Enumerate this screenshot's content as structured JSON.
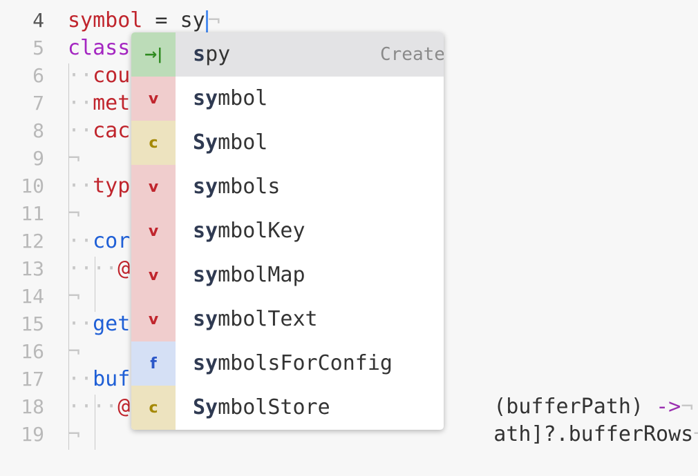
{
  "editor": {
    "lines": [
      {
        "num": "4",
        "current": true,
        "ws": "",
        "tokens": [
          [
            "kw-var",
            "symbol"
          ],
          [
            "plain",
            " = "
          ],
          [
            "plain",
            "sy"
          ]
        ],
        "cursor": true,
        "eol": "¬"
      },
      {
        "num": "5",
        "ws": "",
        "tokens": [
          [
            "kw-class",
            "class"
          ]
        ],
        "eol": ""
      },
      {
        "num": "6",
        "ws": "··",
        "tokens": [
          [
            "kw-var",
            "cou"
          ]
        ],
        "eol": ""
      },
      {
        "num": "7",
        "ws": "··",
        "tokens": [
          [
            "kw-var",
            "met"
          ]
        ],
        "eol": ""
      },
      {
        "num": "8",
        "ws": "··",
        "tokens": [
          [
            "kw-var",
            "cac"
          ]
        ],
        "eol": ""
      },
      {
        "num": "9",
        "ws": "",
        "tokens": [],
        "eol": "¬"
      },
      {
        "num": "10",
        "ws": "··",
        "tokens": [
          [
            "kw-var",
            "typ"
          ]
        ],
        "eol": ""
      },
      {
        "num": "11",
        "ws": "",
        "tokens": [],
        "eol": "¬"
      },
      {
        "num": "12",
        "ws": "··",
        "tokens": [
          [
            "kw-fn",
            "cor"
          ]
        ],
        "eol": ""
      },
      {
        "num": "13",
        "ws": "····",
        "tokens": [
          [
            "kw-var",
            "@"
          ]
        ],
        "eol": ""
      },
      {
        "num": "14",
        "ws": "",
        "tokens": [],
        "eol": "¬"
      },
      {
        "num": "15",
        "ws": "··",
        "tokens": [
          [
            "kw-fn",
            "get"
          ]
        ],
        "eol": ""
      },
      {
        "num": "16",
        "ws": "",
        "tokens": [],
        "eol": "¬"
      },
      {
        "num": "17",
        "ws": "··",
        "tokens": [
          [
            "kw-fn",
            "buf"
          ]
        ],
        "eol": ""
      },
      {
        "num": "18",
        "ws": "····",
        "tokens": [
          [
            "kw-var",
            "@"
          ]
        ],
        "eol": ""
      },
      {
        "num": "19",
        "ws": "",
        "tokens": [],
        "eol": "¬"
      }
    ],
    "right_fragments": {
      "line17": {
        "text": "(bufferPath) ",
        "arrow": "->",
        "eol": "¬"
      },
      "line18": {
        "text": "ath]?.bufferRows",
        "eol": "¬"
      }
    }
  },
  "autocomplete": {
    "items": [
      {
        "kind": "s",
        "badge_text": "→|",
        "match": "s",
        "rest": "py",
        "description": "Create Jasmine …",
        "selected": true
      },
      {
        "kind": "v",
        "badge_text": "v",
        "match": "sy",
        "rest": "mbol",
        "description": ""
      },
      {
        "kind": "c",
        "badge_text": "c",
        "match": "Sy",
        "rest": "mbol",
        "description": ""
      },
      {
        "kind": "v",
        "badge_text": "v",
        "match": "sy",
        "rest": "mbols",
        "description": ""
      },
      {
        "kind": "v",
        "badge_text": "v",
        "match": "sy",
        "rest": "mbolKey",
        "description": ""
      },
      {
        "kind": "v",
        "badge_text": "v",
        "match": "sy",
        "rest": "mbolMap",
        "description": ""
      },
      {
        "kind": "v",
        "badge_text": "v",
        "match": "sy",
        "rest": "mbolText",
        "description": ""
      },
      {
        "kind": "f",
        "badge_text": "f",
        "match": "sy",
        "rest": "mbolsForConfig",
        "description": ""
      },
      {
        "kind": "c",
        "badge_text": "c",
        "match": "Sy",
        "rest": "mbolStore",
        "description": ""
      }
    ]
  }
}
